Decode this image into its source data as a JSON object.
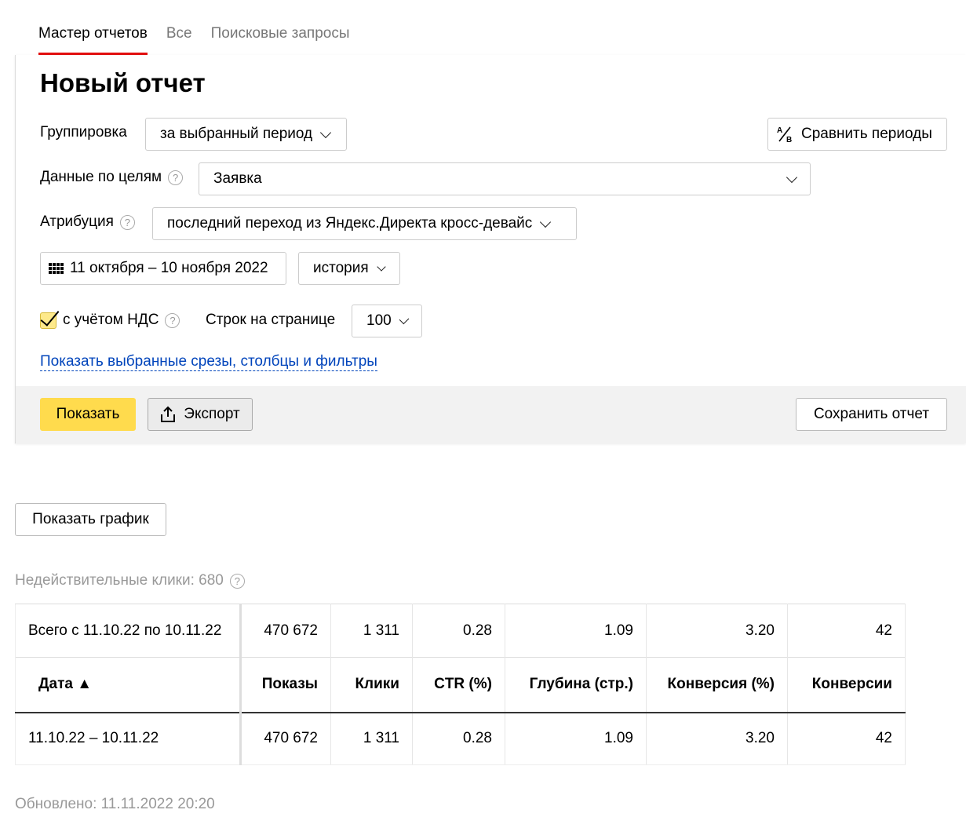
{
  "tabs": [
    {
      "label": "Мастер отчетов",
      "active": true
    },
    {
      "label": "Все",
      "active": false
    },
    {
      "label": "Поисковые запросы",
      "active": false
    }
  ],
  "page_title": "Новый отчет",
  "grouping": {
    "label": "Группировка",
    "value": "за выбранный период"
  },
  "compare_button": {
    "icon": "compare-ab-icon",
    "label": "Сравнить периоды"
  },
  "goals": {
    "label": "Данные по целям",
    "value": "Заявка"
  },
  "attribution": {
    "label": "Атрибуция",
    "value": "последний переход из Яндекс.Директа кросс-девайс"
  },
  "date_range": {
    "icon": "calendar-icon",
    "value": "11 октября – 10 ноября 2022"
  },
  "history": {
    "value": "история"
  },
  "vat": {
    "label": "с учётом НДС",
    "checked": true
  },
  "rows_per_page": {
    "label": "Строк на странице",
    "value": "100"
  },
  "show_slices_link": "Показать выбранные срезы, столбцы и фильтры",
  "footer": {
    "show_label": "Показать",
    "export_label": "Экспорт",
    "save_label": "Сохранить отчет"
  },
  "show_chart_label": "Показать график",
  "invalid_clicks": "Недействительные клики: 680",
  "table": {
    "total": [
      "Всего с 11.10.22 по 10.11.22",
      "470 672",
      "1 311",
      "0.28",
      "1.09",
      "3.20",
      "42"
    ],
    "headers": [
      "Дата ▲",
      "Показы",
      "Клики",
      "CTR (%)",
      "Глубина (стр.)",
      "Конверсия (%)",
      "Конверсии"
    ],
    "rows": [
      [
        "11.10.22 – 10.11.22",
        "470 672",
        "1 311",
        "0.28",
        "1.09",
        "3.20",
        "42"
      ]
    ]
  },
  "updated": "Обновлено: 11.11.2022 20:20",
  "colors": {
    "accent_red": "#e30e0e",
    "button_yellow": "#ffdb4d",
    "link_blue": "#0044bb"
  }
}
